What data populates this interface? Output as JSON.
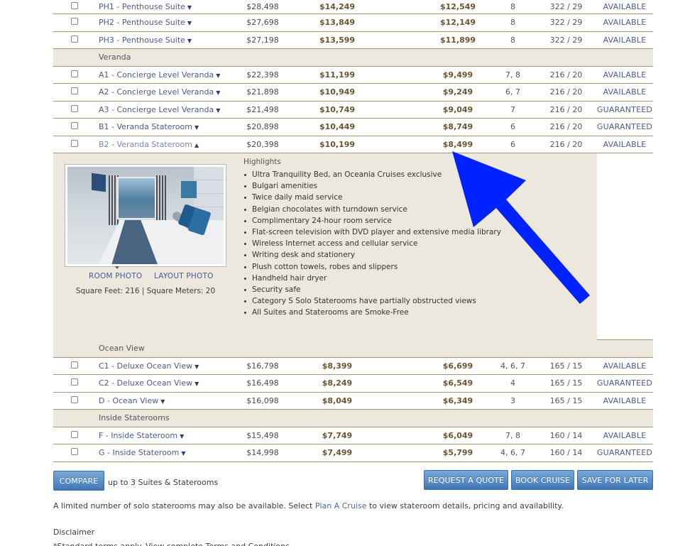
{
  "rows": [
    {
      "type": "room",
      "name": "PH1 - Penthouse Suite",
      "caret": "▼",
      "full_fare": "$28,498",
      "price1": "$14,249",
      "price2": "$12,549",
      "decks": "8",
      "size": "322 / 29",
      "status": "AVAILABLE"
    },
    {
      "type": "room",
      "name": "PH2 - Penthouse Suite",
      "caret": "▼",
      "full_fare": "$27,698",
      "price1": "$13,849",
      "price2": "$12,149",
      "decks": "8",
      "size": "322 / 29",
      "status": "AVAILABLE"
    },
    {
      "type": "room",
      "name": "PH3 - Penthouse Suite",
      "caret": "▼",
      "full_fare": "$27,198",
      "price1": "$13,599",
      "price2": "$11,899",
      "decks": "8",
      "size": "322 / 29",
      "status": "AVAILABLE"
    },
    {
      "type": "category",
      "name": "Veranda"
    },
    {
      "type": "room",
      "name": "A1 - Concierge Level Veranda",
      "caret": "▼",
      "full_fare": "$22,398",
      "price1": "$11,199",
      "price2": "$9,499",
      "decks": "7, 8",
      "size": "216 / 20",
      "status": "AVAILABLE"
    },
    {
      "type": "room",
      "name": "A2 - Concierge Level Veranda",
      "caret": "▼",
      "full_fare": "$21,898",
      "price1": "$10,949",
      "price2": "$9,249",
      "decks": "6, 7",
      "size": "216 / 20",
      "status": "AVAILABLE"
    },
    {
      "type": "room",
      "name": "A3 - Concierge Level Veranda",
      "caret": "▼",
      "full_fare": "$21,498",
      "price1": "$10,749",
      "price2": "$9,049",
      "decks": "7",
      "size": "216 / 20",
      "status": "GUARANTEED"
    },
    {
      "type": "room",
      "name": "B1 - Veranda Stateroom",
      "caret": "▼",
      "full_fare": "$20,898",
      "price1": "$10,449",
      "price2": "$8,749",
      "decks": "6",
      "size": "216 / 20",
      "status": "GUARANTEED"
    },
    {
      "type": "room",
      "name": "B2 - Veranda Stateroom",
      "caret": "▲",
      "full_fare": "$20,398",
      "price1": "$10,199",
      "price2": "$8,499",
      "decks": "6",
      "size": "216 / 20",
      "status": "AVAILABLE",
      "expanded": true
    },
    {
      "type": "category",
      "name": "Ocean View"
    },
    {
      "type": "room",
      "name": "C1 - Deluxe Ocean View",
      "caret": "▼",
      "full_fare": "$16,798",
      "price1": "$8,399",
      "price2": "$6,699",
      "decks": "4, 6, 7",
      "size": "165 / 15",
      "status": "AVAILABLE"
    },
    {
      "type": "room",
      "name": "C2 - Deluxe Ocean View",
      "caret": "▼",
      "full_fare": "$16,498",
      "price1": "$8,249",
      "price2": "$6,549",
      "decks": "4",
      "size": "165 / 15",
      "status": "GUARANTEED"
    },
    {
      "type": "room",
      "name": "D - Ocean View",
      "caret": "▼",
      "full_fare": "$16,098",
      "price1": "$8,049",
      "price2": "$6,349",
      "decks": "3",
      "size": "165 / 15",
      "status": "AVAILABLE"
    },
    {
      "type": "category",
      "name": "Inside Staterooms"
    },
    {
      "type": "room",
      "name": "F - Inside Stateroom",
      "caret": "▼",
      "full_fare": "$15,498",
      "price1": "$7,749",
      "price2": "$6,049",
      "decks": "7, 8",
      "size": "160 / 14",
      "status": "AVAILABLE"
    },
    {
      "type": "room",
      "name": "G - Inside Stateroom",
      "caret": "▼",
      "full_fare": "$14,998",
      "price1": "$7,499",
      "price2": "$5,799",
      "decks": "4, 6, 7",
      "size": "160 / 14",
      "status": "GUARANTEED"
    }
  ],
  "detail": {
    "photo_tabs": {
      "room": "ROOM PHOTO",
      "layout": "LAYOUT PHOTO"
    },
    "sqft": "Square Feet: 216 | Square Meters: 20",
    "highlights_title": "Highlights",
    "highlights": [
      "Ultra Tranquility Bed, an Oceania Cruises exclusive",
      "Bulgari amenities",
      "Twice daily maid service",
      "Belgian chocolates with turndown service",
      "Complimentary 24-hour room service",
      "Flat-screen television with DVD player and extensive media library",
      "Wireless Internet access and cellular service",
      "Writing desk and stationery",
      "Plush cotton towels, robes and slippers",
      "Handheld hair dryer",
      "Security safe",
      "Category S Solo Staterooms have partially obstructed views",
      "All Suites and Staterooms are Smoke-Free"
    ]
  },
  "actions": {
    "compare": "COMPARE",
    "compare_note": "up to 3 Suites & Staterooms",
    "request_quote": "REQUEST A QUOTE",
    "book_cruise": "BOOK CRUISE",
    "save_for_later": "SAVE FOR LATER"
  },
  "footer": {
    "solo_before": "A limited number of solo staterooms may also be available. Select ",
    "solo_link": "Plan A Cruise",
    "solo_after": " to view stateroom details, pricing and availability.",
    "disclaimer_title": "Disclaimer",
    "disclaimer_text": "*Standard terms apply. View complete Terms and Conditions"
  },
  "annotation": {
    "type": "arrow",
    "color": "#0022ff",
    "points_to": "B2 price $8,499"
  }
}
